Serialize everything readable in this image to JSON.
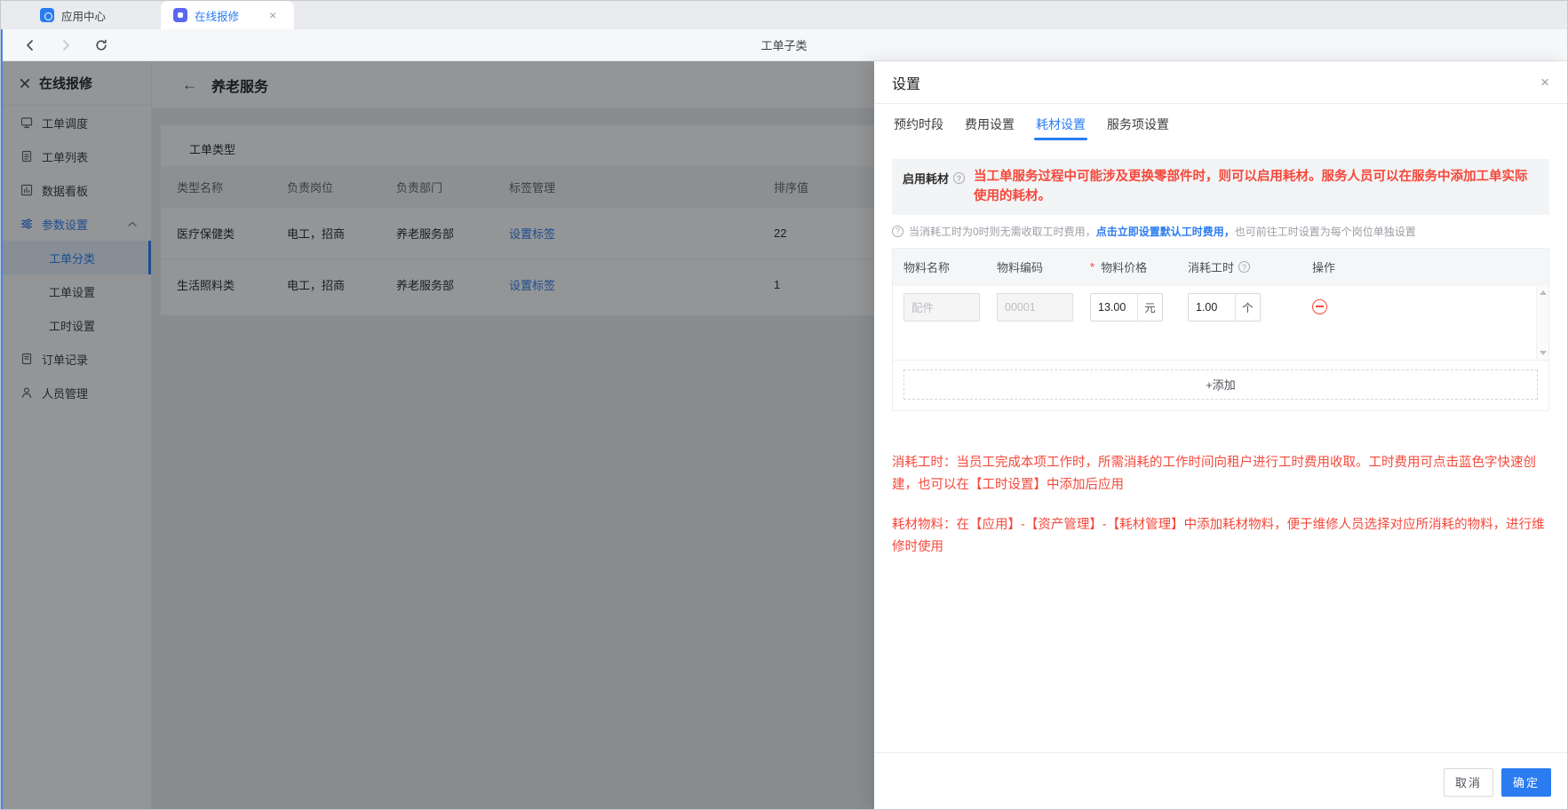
{
  "colors": {
    "accent": "#2b7cf0",
    "danger": "#f5483b",
    "mask": "rgba(16,19,24,0.45)"
  },
  "icons": {
    "close": "×",
    "tab_close": "×",
    "page_back": "←",
    "info": "?"
  },
  "browser": {
    "tabs": [
      {
        "label": "应用中心"
      },
      {
        "label": "在线报修"
      }
    ],
    "nav": {
      "title": "工单子类"
    }
  },
  "sidebar": {
    "title": "在线报修",
    "items": [
      {
        "label": "工单调度"
      },
      {
        "label": "工单列表"
      },
      {
        "label": "数据看板"
      },
      {
        "label": "参数设置"
      },
      {
        "label": "订单记录"
      },
      {
        "label": "人员管理"
      }
    ],
    "subitems": [
      {
        "label": "工单分类"
      },
      {
        "label": "工单设置"
      },
      {
        "label": "工时设置"
      }
    ]
  },
  "main": {
    "page_title": "养老服务",
    "card_title": "工单类型",
    "table": {
      "headers": [
        "类型名称",
        "负责岗位",
        "负责部门",
        "标签管理",
        "排序值"
      ],
      "rows": [
        {
          "name": "医疗保健类",
          "position": "电工，招商",
          "department": "养老服务部",
          "tag_action": "设置标签",
          "sort": "22"
        },
        {
          "name": "生活照料类",
          "position": "电工，招商",
          "department": "养老服务部",
          "tag_action": "设置标签",
          "sort": "1"
        }
      ]
    }
  },
  "drawer": {
    "title": "设置",
    "tabs": [
      {
        "label": "预约时段"
      },
      {
        "label": "费用设置"
      },
      {
        "label": "耗材设置"
      },
      {
        "label": "服务项设置"
      }
    ],
    "enable": {
      "label": "启用耗材",
      "warning": "当工单服务过程中可能涉及更换零部件时，则可以启用耗材。服务人员可以在服务中添加工单实际使用的耗材。"
    },
    "hint": {
      "prefix": "当消耗工时为0时则无需收取工时费用，",
      "link": "点击立即设置默认工时费用，",
      "suffix": "也可前往工时设置为每个岗位单独设置"
    },
    "materials": {
      "headers": [
        "物料名称",
        "物料编码",
        "物料价格",
        "消耗工时",
        "操作"
      ],
      "required_marker": "*",
      "row": {
        "name": "配件",
        "code": "00001",
        "price": "13.00",
        "price_unit": "元",
        "hours": "1.00",
        "hours_unit": "个"
      }
    },
    "add_label": "+添加",
    "notes": [
      "消耗工时：当员工完成本项工作时，所需消耗的工作时间向租户进行工时费用收取。工时费用可点击蓝色字快速创建，也可以在【工时设置】中添加后应用",
      "耗材物料：在【应用】-【资产管理】-【耗材管理】中添加耗材物料，便于维修人员选择对应所消耗的物料，进行维修时使用"
    ],
    "cancel_label": "取消",
    "ok_label": "确定"
  }
}
